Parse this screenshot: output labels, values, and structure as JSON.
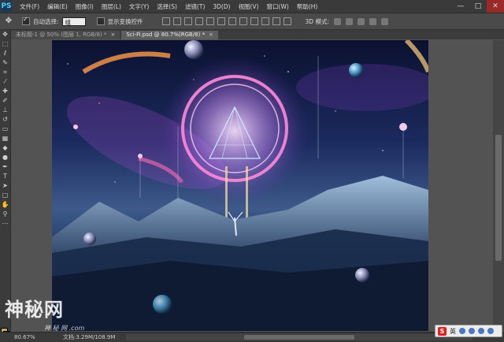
{
  "app": {
    "logo": "PS"
  },
  "menu": [
    "文件(F)",
    "编辑(E)",
    "图像(I)",
    "图层(L)",
    "文字(Y)",
    "选择(S)",
    "滤镜(T)",
    "3D(D)",
    "视图(V)",
    "窗口(W)",
    "帮助(H)"
  ],
  "window_controls": {
    "minimize": "—",
    "maximize": "□",
    "close": "✕"
  },
  "options": {
    "auto_select_label": "自动选择:",
    "auto_select_value": "组",
    "show_transform_label": "显示变换控件",
    "mode_3d_label": "3D 模式:"
  },
  "tabs": [
    {
      "label": "未标题-1 @ 50% (图层 1, RGB/8) *",
      "active": false
    },
    {
      "label": "Sci-Fi.psd @ 80.7%(RGB/8) *",
      "active": true
    }
  ],
  "status": {
    "zoom": "80.67%",
    "doc": "文档:3.29M/108.9M"
  },
  "watermark": {
    "big": "神秘网",
    "small": "神 秘 网 .com"
  },
  "ime": {
    "label": "英"
  },
  "colors": {
    "foreground": "#c8a36a",
    "background": "#ffffff",
    "close_button": "#9a2a2a"
  }
}
